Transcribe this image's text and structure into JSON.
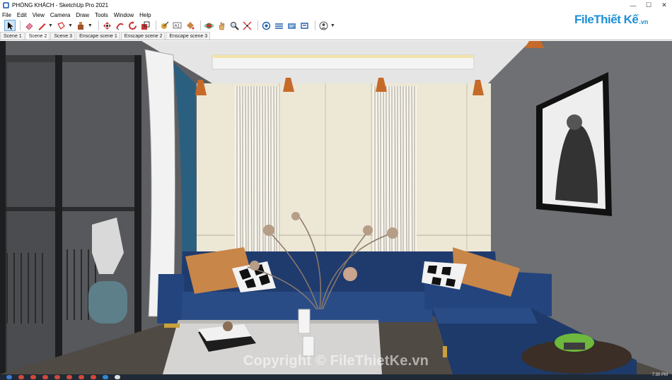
{
  "window": {
    "title": "PHÒNG KHÁCH - SketchUp Pro 2021",
    "controls": {
      "minimize": "—",
      "maximize": "☐",
      "close": "✕"
    }
  },
  "menu": [
    "File",
    "Edit",
    "View",
    "Camera",
    "Draw",
    "Tools",
    "Window",
    "Help"
  ],
  "toolbar": {
    "tools": [
      {
        "icon": "select-arrow-icon",
        "active": true
      },
      {
        "icon": "eraser-icon"
      },
      {
        "icon": "pencil-line-icon",
        "dropdown": true
      },
      {
        "icon": "lasso-icon",
        "dropdown": true
      },
      {
        "icon": "push-pull-icon",
        "dropdown": true
      },
      {
        "icon": "move-icon"
      },
      {
        "icon": "follow-me-icon"
      },
      {
        "icon": "rotate-icon"
      },
      {
        "icon": "scale-icon"
      },
      {
        "icon": "offset-icon"
      },
      {
        "icon": "tape-measure-icon"
      },
      {
        "icon": "text-icon"
      },
      {
        "icon": "paint-bucket-icon"
      },
      {
        "icon": "orbit-icon"
      },
      {
        "icon": "pan-icon"
      },
      {
        "icon": "zoom-icon"
      },
      {
        "icon": "zoom-extents-icon"
      },
      {
        "icon": "warehouse-icon"
      },
      {
        "icon": "extension-warehouse-icon"
      },
      {
        "icon": "layout-icon"
      },
      {
        "icon": "extension-manager-icon"
      },
      {
        "icon": "account-icon",
        "dropdown": true
      }
    ],
    "text_tool_label": "A1"
  },
  "scenes": [
    {
      "label": "Scene 1",
      "active": false
    },
    {
      "label": "Scene 2",
      "active": true
    },
    {
      "label": "Scene 3",
      "active": false
    },
    {
      "label": "Enscape scene 1",
      "active": false
    },
    {
      "label": "Enscape scene 2",
      "active": false
    },
    {
      "label": "Enscape scene 3",
      "active": false
    }
  ],
  "logo": {
    "main": "FileThiết Kế",
    "domain": ".vn"
  },
  "watermark": "Copyright © FileThietKe.vn",
  "taskbar": {
    "clock": "7:30 PM"
  },
  "colors": {
    "sofa": "#1f3b6e",
    "pillow_orange": "#c98649",
    "curtain_blue": "#2b5f7f",
    "wall_back": "#ede7d6",
    "wall_side": "#6d6e70",
    "ceiling": "#e5e5e5",
    "logo_blue": "#1e8fd8"
  }
}
